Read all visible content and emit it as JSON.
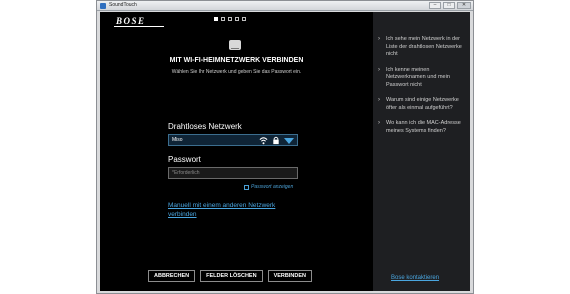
{
  "window": {
    "title": "SoundTouch",
    "minimize": "–",
    "maximize": "□",
    "close": "✕"
  },
  "brand": {
    "logo_text": "BOSE"
  },
  "progress": {
    "total_steps": 5,
    "current_step": 1
  },
  "main": {
    "heading": "MIT WI-FI-HEIMNETZWERK VERBINDEN",
    "subheading": "Wählen Sie Ihr Netzwerk und geben Sie das Passwort ein.",
    "network_label": "Drahtloses Netzwerk",
    "network_value": "Miso",
    "password_label": "Passwort",
    "password_placeholder": "*Erforderlich",
    "show_password_label": "Passwort anzeigen",
    "manual_link": "Manuell mit einem anderen Netzwerk verbinden"
  },
  "buttons": {
    "cancel": "ABBRECHEN",
    "clear": "FELDER LÖSCHEN",
    "connect": "VERBINDEN"
  },
  "sidebar": {
    "items": [
      {
        "label": "Ich sehe mein Netzwerk in der Liste der drahtlosen Netzwerke nicht"
      },
      {
        "label": "Ich kenne meinen Netzwerknamen und mein Passwort nicht"
      },
      {
        "label": "Warum sind einige Netzwerke öfter als einmal aufgeführt?"
      },
      {
        "label": "Wo kann ich die MAC-Adresse meines Systems finden?"
      }
    ],
    "contact_link": "Bose kontaktieren"
  },
  "icons": {
    "network_status": [
      "wifi-icon",
      "lock-icon",
      "dropdown-icon"
    ],
    "help_chevron": "chevron-right-icon"
  },
  "colors": {
    "background": "#000000",
    "sidebar": "#1e1f22",
    "link": "#4aa6e0",
    "select_bg": "#0f2436"
  }
}
